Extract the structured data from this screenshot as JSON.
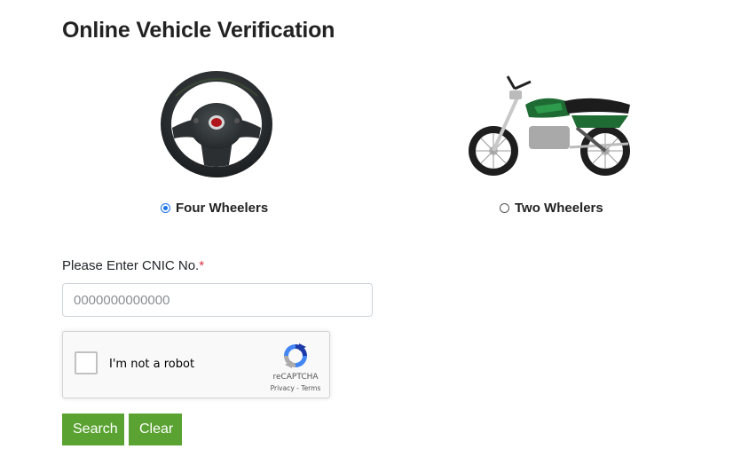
{
  "page": {
    "title": "Online Vehicle Verification"
  },
  "vehicle_types": [
    {
      "label": "Four Wheelers",
      "selected": true,
      "icon": "steering-wheel-icon"
    },
    {
      "label": "Two Wheelers",
      "selected": false,
      "icon": "motorcycle-icon"
    }
  ],
  "cnic": {
    "label": "Please Enter CNIC No.",
    "required_mark": "*",
    "placeholder": "0000000000000",
    "value": ""
  },
  "recaptcha": {
    "checkbox_label": "I'm not a robot",
    "brand": "reCAPTCHA",
    "privacy": "Privacy",
    "separator": " - ",
    "terms": "Terms"
  },
  "buttons": {
    "search": "Search",
    "clear": "Clear"
  },
  "colors": {
    "button_green": "#5aa232",
    "radio_blue": "#1a73e8",
    "required_red": "#dc3545"
  }
}
